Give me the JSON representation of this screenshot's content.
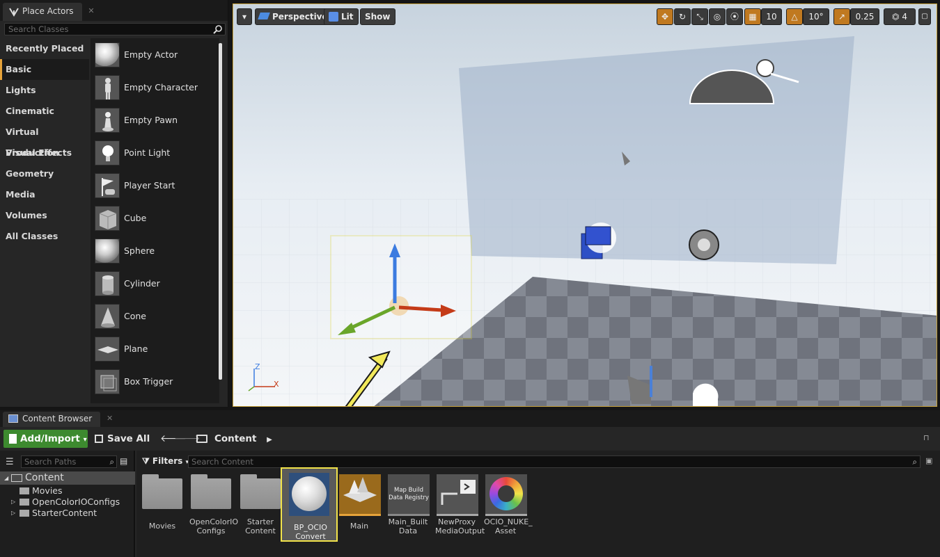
{
  "place_actors": {
    "tab_title": "Place Actors",
    "search_placeholder": "Search Classes",
    "categories": [
      "Recently Placed",
      "Basic",
      "Lights",
      "Cinematic",
      "Virtual Production",
      "Visual Effects",
      "Geometry",
      "Media",
      "Volumes",
      "All Classes"
    ],
    "active_category": "Basic",
    "items": [
      "Empty Actor",
      "Empty Character",
      "Empty Pawn",
      "Point Light",
      "Player Start",
      "Cube",
      "Sphere",
      "Cylinder",
      "Cone",
      "Plane",
      "Box Trigger"
    ]
  },
  "viewport": {
    "perspective_label": "Perspective",
    "lit_label": "Lit",
    "show_label": "Show",
    "grid_snap": "10",
    "rotation_snap": "10°",
    "scale_snap": "0.25",
    "camera_speed": "4",
    "axis_z": "Z",
    "axis_x": "X"
  },
  "content_browser": {
    "tab_title": "Content Browser",
    "add_import_label": "Add/Import",
    "save_all_label": "Save All",
    "breadcrumb": "Content",
    "path_search_placeholder": "Search Paths",
    "filters_label": "Filters",
    "content_search_placeholder": "Search Content",
    "tree": [
      "Content",
      "Movies",
      "OpenColorIOConfigs",
      "StarterContent"
    ],
    "assets": [
      {
        "label": "Movies",
        "type": "folder"
      },
      {
        "label": "OpenColorIO Configs",
        "type": "folder"
      },
      {
        "label": "Starter Content",
        "type": "folder"
      },
      {
        "label": "BP_OCIO Convert",
        "type": "blueprint",
        "selected": true
      },
      {
        "label": "Main",
        "type": "level"
      },
      {
        "label": "Main_Built Data",
        "type": "map-build-data",
        "thumb_text": "Map Build Data Registry"
      },
      {
        "label": "NewProxy MediaOutput",
        "type": "media-output"
      },
      {
        "label": "OCIO_NUKE_ Asset",
        "type": "ocio-asset"
      }
    ]
  },
  "colors": {
    "accent_orange": "#c07920",
    "selection_yellow": "#f2e34a",
    "add_green": "#3d8a2f"
  }
}
